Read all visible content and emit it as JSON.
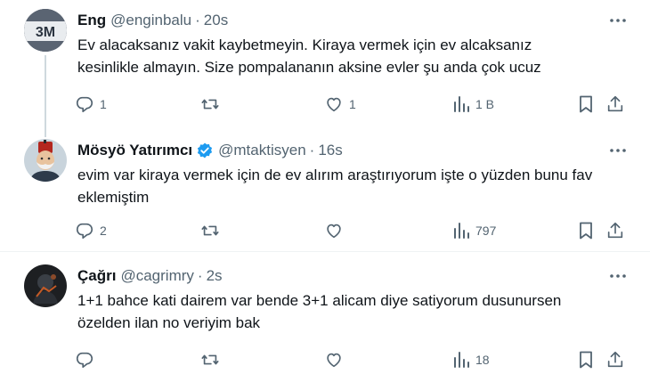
{
  "tweets": [
    {
      "name": "Eng",
      "handle": "@enginbalu",
      "time": "20s",
      "avatar_text": "3M",
      "text": "Ev alacaksanız vakit kaybetmeyin. Kiraya vermek için ev alcaksanız kesinlikle almayın. Size pompalananın aksine evler şu anda çok ucuz",
      "replies": "1",
      "retweets": "",
      "likes": "1",
      "views": "1 B"
    },
    {
      "name": "Mösyö Yatırımcı",
      "handle": "@mtaktisyen",
      "time": "16s",
      "verified": true,
      "text": "evim var kiraya vermek için de ev alırım araştırıyorum işte o yüzden bunu fav eklemiştim",
      "replies": "2",
      "retweets": "",
      "likes": "",
      "views": "797"
    },
    {
      "name": "Çağrı",
      "handle": "@cagrimry",
      "time": "2s",
      "text": "1+1 bahce kati dairem var bende  3+1 alicam diye satiyorum dusunursen özelden ilan no veriyim bak",
      "replies": "",
      "retweets": "",
      "likes": "",
      "views": "18"
    }
  ],
  "colors": {
    "text": "#0f1419",
    "secondary": "#536471",
    "verified": "#1d9bf0",
    "divider": "#eff3f4"
  },
  "icons": [
    "more-icon",
    "reply-icon",
    "retweet-icon",
    "like-icon",
    "views-icon",
    "bookmark-icon",
    "share-icon",
    "verified-icon"
  ]
}
